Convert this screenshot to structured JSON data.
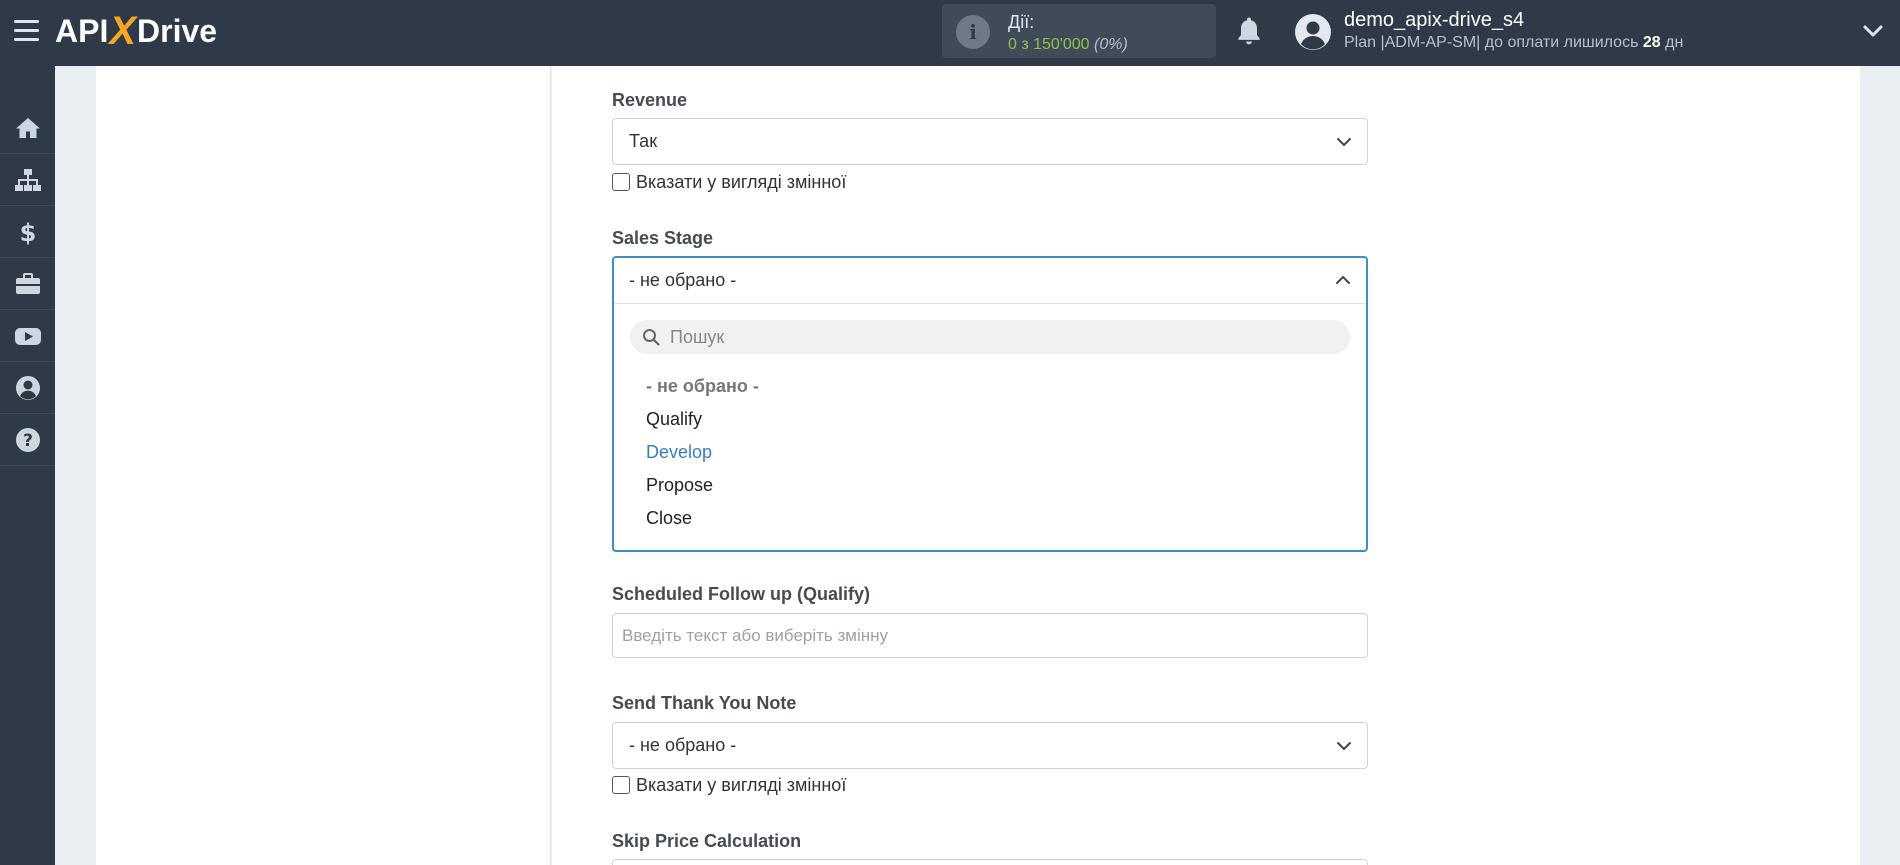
{
  "header": {
    "logo": {
      "part1": "API",
      "part2": "X",
      "part3": "Drive"
    },
    "actions": {
      "label": "Дії:",
      "value": "0 з 150'000",
      "percent": "(0%)"
    },
    "user": {
      "name": "demo_apix-drive_s4",
      "plan_prefix": "Plan |ADM-AP-SM| до оплати лишилось",
      "days": "28",
      "days_unit": "дн"
    }
  },
  "sidebar": {
    "items": [
      {
        "icon": "home-icon"
      },
      {
        "icon": "sitemap-icon"
      },
      {
        "icon": "dollar-icon"
      },
      {
        "icon": "briefcase-icon"
      },
      {
        "icon": "youtube-icon"
      },
      {
        "icon": "user-circle-icon"
      },
      {
        "icon": "help-icon"
      }
    ]
  },
  "form": {
    "revenue": {
      "label": "Revenue",
      "value": "Так",
      "checkbox_label": "Вказати у вигляді змінної"
    },
    "sales_stage": {
      "label": "Sales Stage",
      "value": "- не обрано -",
      "search_placeholder": "Пошук",
      "options": [
        "- не обрано -",
        "Qualify",
        "Develop",
        "Propose",
        "Close"
      ]
    },
    "scheduled_follow_up": {
      "label": "Scheduled Follow up (Qualify)",
      "placeholder": "Введіть текст або виберіть змінну"
    },
    "send_thank_you": {
      "label": "Send Thank You Note",
      "value": "- не обрано -",
      "checkbox_label": "Вказати у вигляді змінної"
    },
    "skip_price": {
      "label": "Skip Price Calculation"
    }
  }
}
